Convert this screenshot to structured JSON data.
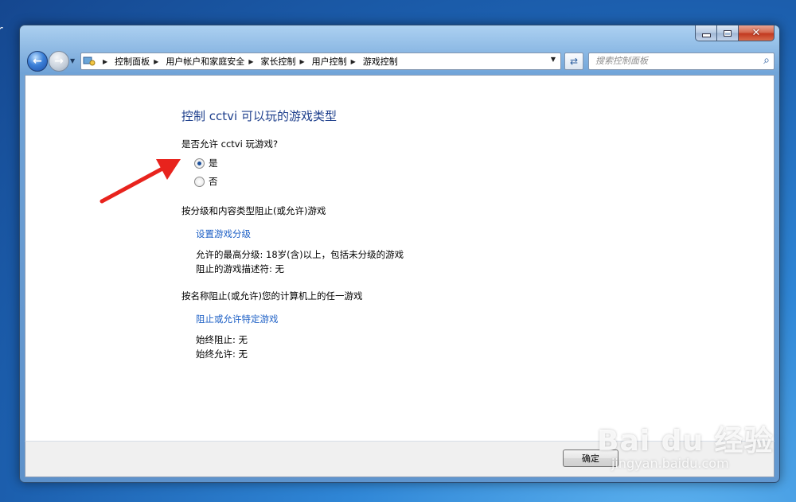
{
  "desktop": {
    "edge_mark": "r"
  },
  "window": {
    "buttons": {
      "minimize": "",
      "maximize": "",
      "close": "✕"
    }
  },
  "address_bar": {
    "breadcrumbs": [
      "控制面板",
      "用户帐户和家庭安全",
      "家长控制",
      "用户控制",
      "游戏控制"
    ],
    "search_placeholder": "搜索控制面板"
  },
  "main": {
    "title": "控制 cctvi 可以玩的游戏类型",
    "question": "是否允许 cctvi 玩游戏?",
    "options": [
      {
        "label": "是",
        "selected": true
      },
      {
        "label": "否",
        "selected": false
      }
    ],
    "rating_section": {
      "heading": "按分级和内容类型阻止(或允许)游戏",
      "link": "设置游戏分级",
      "max_rating": "允许的最高分级:  18岁(含)以上，包括未分级的游戏",
      "blocked_descriptors": "阻止的游戏描述符: 无"
    },
    "name_section": {
      "heading": "按名称阻止(或允许)您的计算机上的任一游戏",
      "link": "阻止或允许特定游戏",
      "always_block": "始终阻止: 无",
      "always_allow": "始终允许: 无"
    }
  },
  "footer": {
    "ok_label": "确定"
  },
  "watermark": {
    "logo": "Bai du 经验",
    "url": "jingyan.baidu.com"
  },
  "colors": {
    "accent_red": "#e8231d",
    "link": "#1c5fc5",
    "title": "#1e3f8c"
  }
}
